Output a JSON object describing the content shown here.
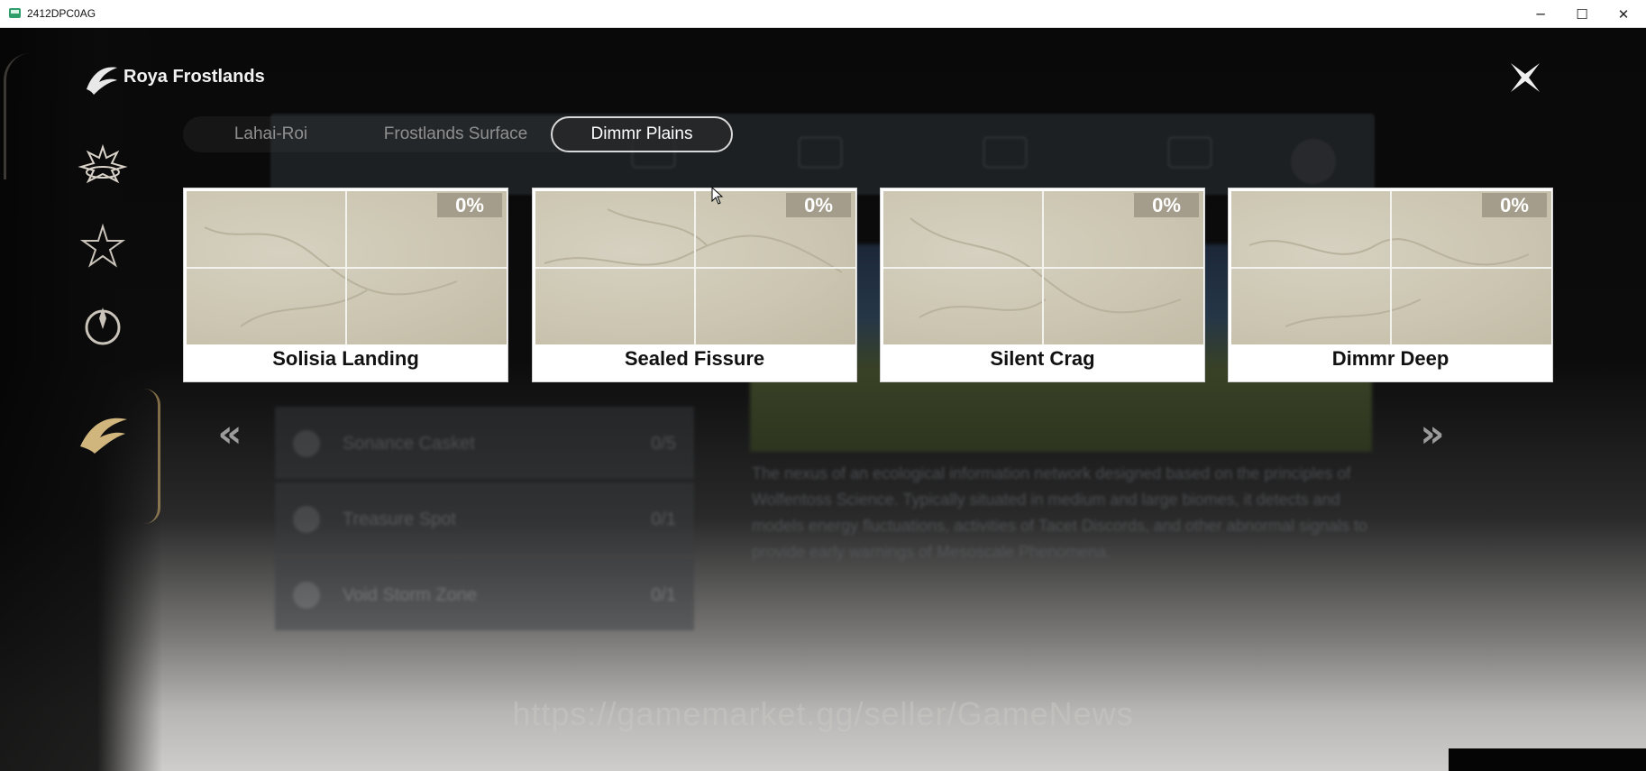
{
  "window": {
    "title": "2412DPC0AG",
    "minimize_glyph": "─",
    "maximize_glyph": "☐",
    "close_glyph": "✕"
  },
  "header": {
    "region_title": "Roya Frostlands"
  },
  "tabs": [
    {
      "label": "Lahai-Roi",
      "active": false
    },
    {
      "label": "Frostlands Surface",
      "active": false
    },
    {
      "label": "Dimmr Plains",
      "active": true
    }
  ],
  "areas": [
    {
      "name": "Solisia Landing",
      "progress": "0%"
    },
    {
      "name": "Sealed Fissure",
      "progress": "0%"
    },
    {
      "name": "Silent Crag",
      "progress": "0%"
    },
    {
      "name": "Dimmr Deep",
      "progress": "0%"
    }
  ],
  "nav": {
    "prev_glyph": "«",
    "next_glyph": "»"
  },
  "background": {
    "list_rows": [
      {
        "label": "Sonance Casket",
        "count": "0/5"
      },
      {
        "label": "Treasure Spot",
        "count": "0/1"
      },
      {
        "label": "Void Storm Zone",
        "count": "0/1"
      }
    ],
    "description": "The nexus of an ecological information network designed based on the principles of Wolfentoss Science. Typically situated in medium and large biomes, it detects and models energy fluctuations, activities of Tacet Discords, and other abnormal signals to provide early warnings of Mesoscale Phenomena."
  },
  "watermark": "https://gamemarket.gg/seller/GameNews",
  "colors": {
    "accent_gold": "#c9a96a",
    "card_badge": "#a49d8b"
  }
}
